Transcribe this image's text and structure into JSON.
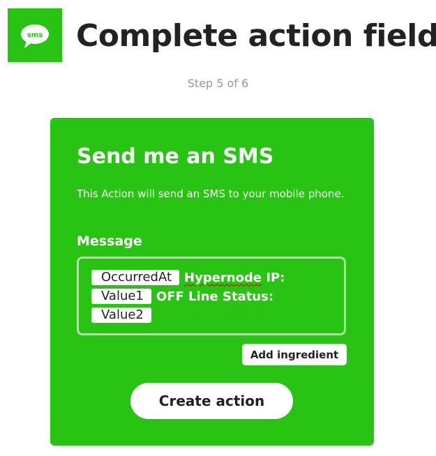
{
  "header": {
    "logo_text": "sms",
    "title": "Complete action fields",
    "step": "Step 5 of 6"
  },
  "card": {
    "title": "Send me an SMS",
    "description": "This Action will send an SMS to your mobile phone.",
    "field_label": "Message",
    "message": {
      "ingredient_1": "OccurredAt",
      "text_1a": "Hypernode",
      "text_1b": " IP:",
      "ingredient_2": "Value1",
      "text_2": "OFF Line Status:",
      "ingredient_3": "Value2"
    },
    "add_ingredient_label": "Add ingredient",
    "create_action_label": "Create action"
  },
  "colors": {
    "brand_green": "#29c314",
    "title_text": "#222222",
    "step_text": "#999999"
  }
}
